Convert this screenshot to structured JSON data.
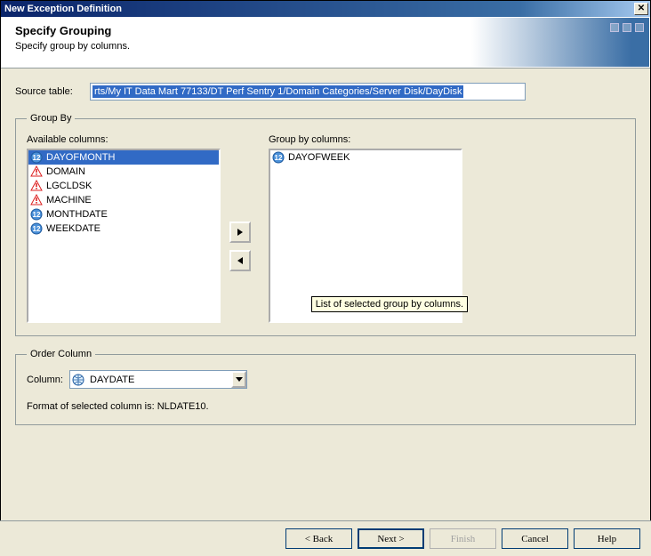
{
  "window": {
    "title": "New Exception Definition"
  },
  "banner": {
    "heading": "Specify Grouping",
    "subheading": "Specify group by columns."
  },
  "source": {
    "label": "Source table:",
    "value": "rts/My IT Data Mart 77133/DT Perf Sentry 1/Domain Categories/Server Disk/DayDisk"
  },
  "groupby": {
    "legend": "Group By",
    "available_label": "Available columns:",
    "selected_label": "Group by columns:",
    "available": [
      {
        "label": "DAYOFMONTH",
        "icon": "num",
        "selected": true
      },
      {
        "label": "DOMAIN",
        "icon": "warn"
      },
      {
        "label": "LGCLDSK",
        "icon": "warn"
      },
      {
        "label": "MACHINE",
        "icon": "warn"
      },
      {
        "label": "MONTHDATE",
        "icon": "num"
      },
      {
        "label": "WEEKDATE",
        "icon": "num"
      }
    ],
    "selected": [
      {
        "label": "DAYOFWEEK",
        "icon": "num"
      }
    ],
    "tooltip": "List of selected group by columns."
  },
  "order": {
    "legend": "Order Column",
    "column_label": "Column:",
    "column_value": "DAYDATE",
    "format_line": "Format of selected column is:   NLDATE10."
  },
  "footer": {
    "back": "< Back",
    "next": "Next >",
    "finish": "Finish",
    "cancel": "Cancel",
    "help": "Help"
  }
}
